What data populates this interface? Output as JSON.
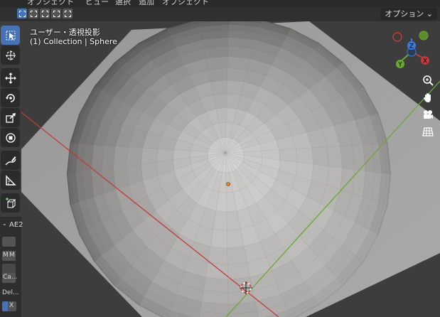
{
  "header": {
    "menu_strip": [
      "オブジェクト",
      "ビュー",
      "選択",
      "追加",
      "オブジェクト"
    ],
    "options_label": "オプション ⌄"
  },
  "viewport": {
    "view_label": "ユーザー・透視投影",
    "collection_label": "(1) Collection | Sphere"
  },
  "gizmo": {
    "z_label": "Z",
    "y_label": "Y",
    "x_label": "X"
  },
  "side_panel": {
    "title": "AE2",
    "m1": "M",
    "m2": "M",
    "ca": "Ca...",
    "del": "Del...",
    "x": "X"
  },
  "colors": {
    "accent": "#4772b3",
    "x_axis": "#c23a3a",
    "y_axis": "#6aa832",
    "z_axis": "#3d7ad6"
  },
  "icons": {
    "select_tool": "cursor-arrow-icon",
    "cursor_tool": "3d-cursor-icon",
    "move_tool": "move-icon",
    "rotate_tool": "rotate-icon",
    "scale_tool": "scale-icon",
    "transform_tool": "transform-icon",
    "annotate_tool": "annotate-icon",
    "measure_tool": "measure-icon",
    "add_cube_tool": "add-cube-icon",
    "zoom": "zoom-icon",
    "pan": "hand-icon",
    "camera": "camera-icon",
    "grid": "grid-icon"
  }
}
